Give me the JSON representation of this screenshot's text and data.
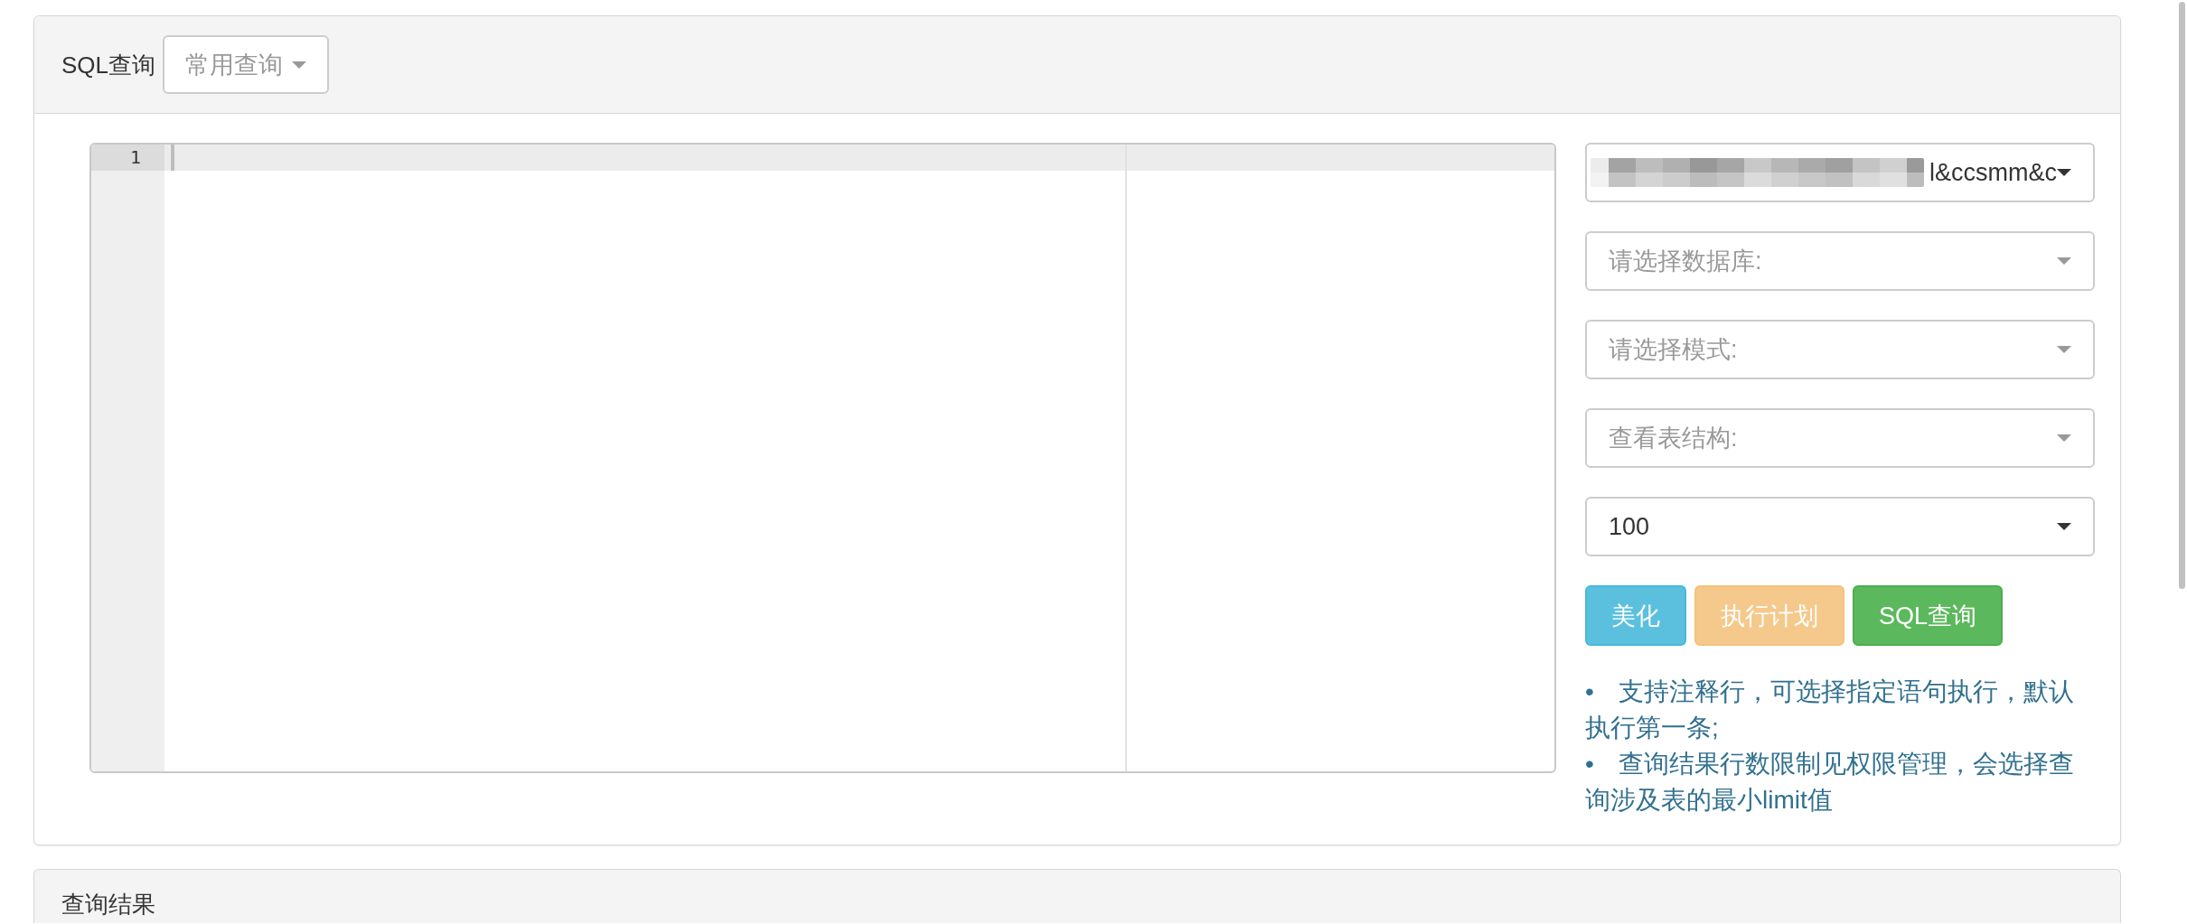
{
  "query_panel": {
    "title": "SQL查询",
    "common_query_dropdown": {
      "label": "常用查询"
    }
  },
  "editor": {
    "lines": [
      {
        "number": "1",
        "active": true
      }
    ]
  },
  "selectors": [
    {
      "value": "l&ccsmm&c",
      "redacted": true
    },
    {
      "placeholder": "请选择数据库:",
      "redacted": false
    },
    {
      "placeholder": "请选择模式:",
      "redacted": false
    },
    {
      "placeholder": "查看表结构:",
      "redacted": false
    },
    {
      "value": "100",
      "redacted": false
    }
  ],
  "buttons": [
    {
      "label": "美化",
      "kind": "info",
      "disabled": false
    },
    {
      "label": "执行计划",
      "kind": "warning",
      "disabled": true
    },
    {
      "label": "SQL查询",
      "kind": "success",
      "disabled": false
    }
  ],
  "notes": [
    {
      "bullet": "•",
      "text": "支持注释行，可选择指定语句执行，默认执行第一条;"
    },
    {
      "bullet": "•",
      "text": "查询结果行数限制见权限管理，会选择查询涉及表的最小limit值"
    }
  ],
  "results_panel": {
    "title": "查询结果"
  }
}
